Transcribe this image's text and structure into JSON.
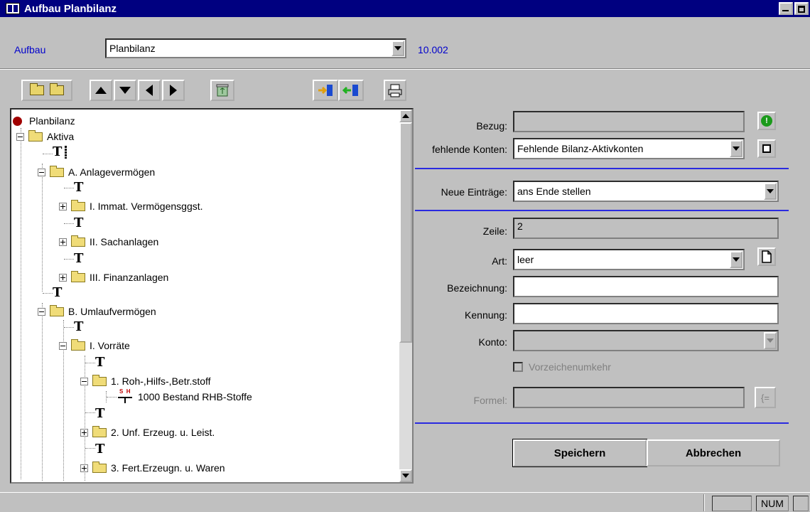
{
  "window": {
    "title": "Aufbau Planbilanz"
  },
  "header": {
    "label": "Aufbau",
    "combo_value": "Planbilanz",
    "version": "10.002"
  },
  "tree": {
    "items": [
      {
        "label": "Planbilanz"
      },
      {
        "label": "Aktiva"
      },
      {
        "label": "A. Anlagevermögen"
      },
      {
        "label": "I. Immat. Vermögensggst."
      },
      {
        "label": "II. Sachanlagen"
      },
      {
        "label": "III. Finanzanlagen"
      },
      {
        "label": "B. Umlaufvermögen"
      },
      {
        "label": "I. Vorräte"
      },
      {
        "label": "1. Roh-,Hilfs-,Betr.stoff"
      },
      {
        "label": "1000 Bestand RHB-Stoffe"
      },
      {
        "label": "2. Unf. Erzeug. u. Leist."
      },
      {
        "label": "3. Fert.Erzeugn. u. Waren"
      }
    ],
    "text_glyph": "T",
    "account_marker": "S  H"
  },
  "form": {
    "bezug": {
      "label": "Bezug:",
      "value": ""
    },
    "fehlende": {
      "label": "fehlende Konten:",
      "value": "Fehlende Bilanz-Aktivkonten"
    },
    "neue": {
      "label": "Neue Einträge:",
      "value": "ans Ende stellen"
    },
    "zeile": {
      "label": "Zeile:",
      "value": "2"
    },
    "art": {
      "label": "Art:",
      "value": "leer"
    },
    "bezeichnung": {
      "label": "Bezeichnung:",
      "value": ""
    },
    "kennung": {
      "label": "Kennung:",
      "value": ""
    },
    "konto": {
      "label": "Konto:",
      "value": ""
    },
    "vorzeichen": {
      "label": "Vorzeichenumkehr"
    },
    "formel": {
      "label": "Formel:",
      "value": "",
      "btn": "{="
    },
    "info_glyph": "!"
  },
  "buttons": {
    "save": "Speichern",
    "cancel": "Abbrechen"
  },
  "status": {
    "num": "NUM"
  },
  "colors": {
    "titlebar": "#000080",
    "accent_link": "#0000cc",
    "separator": "#2a2ae0",
    "root_dot": "#a00000"
  }
}
